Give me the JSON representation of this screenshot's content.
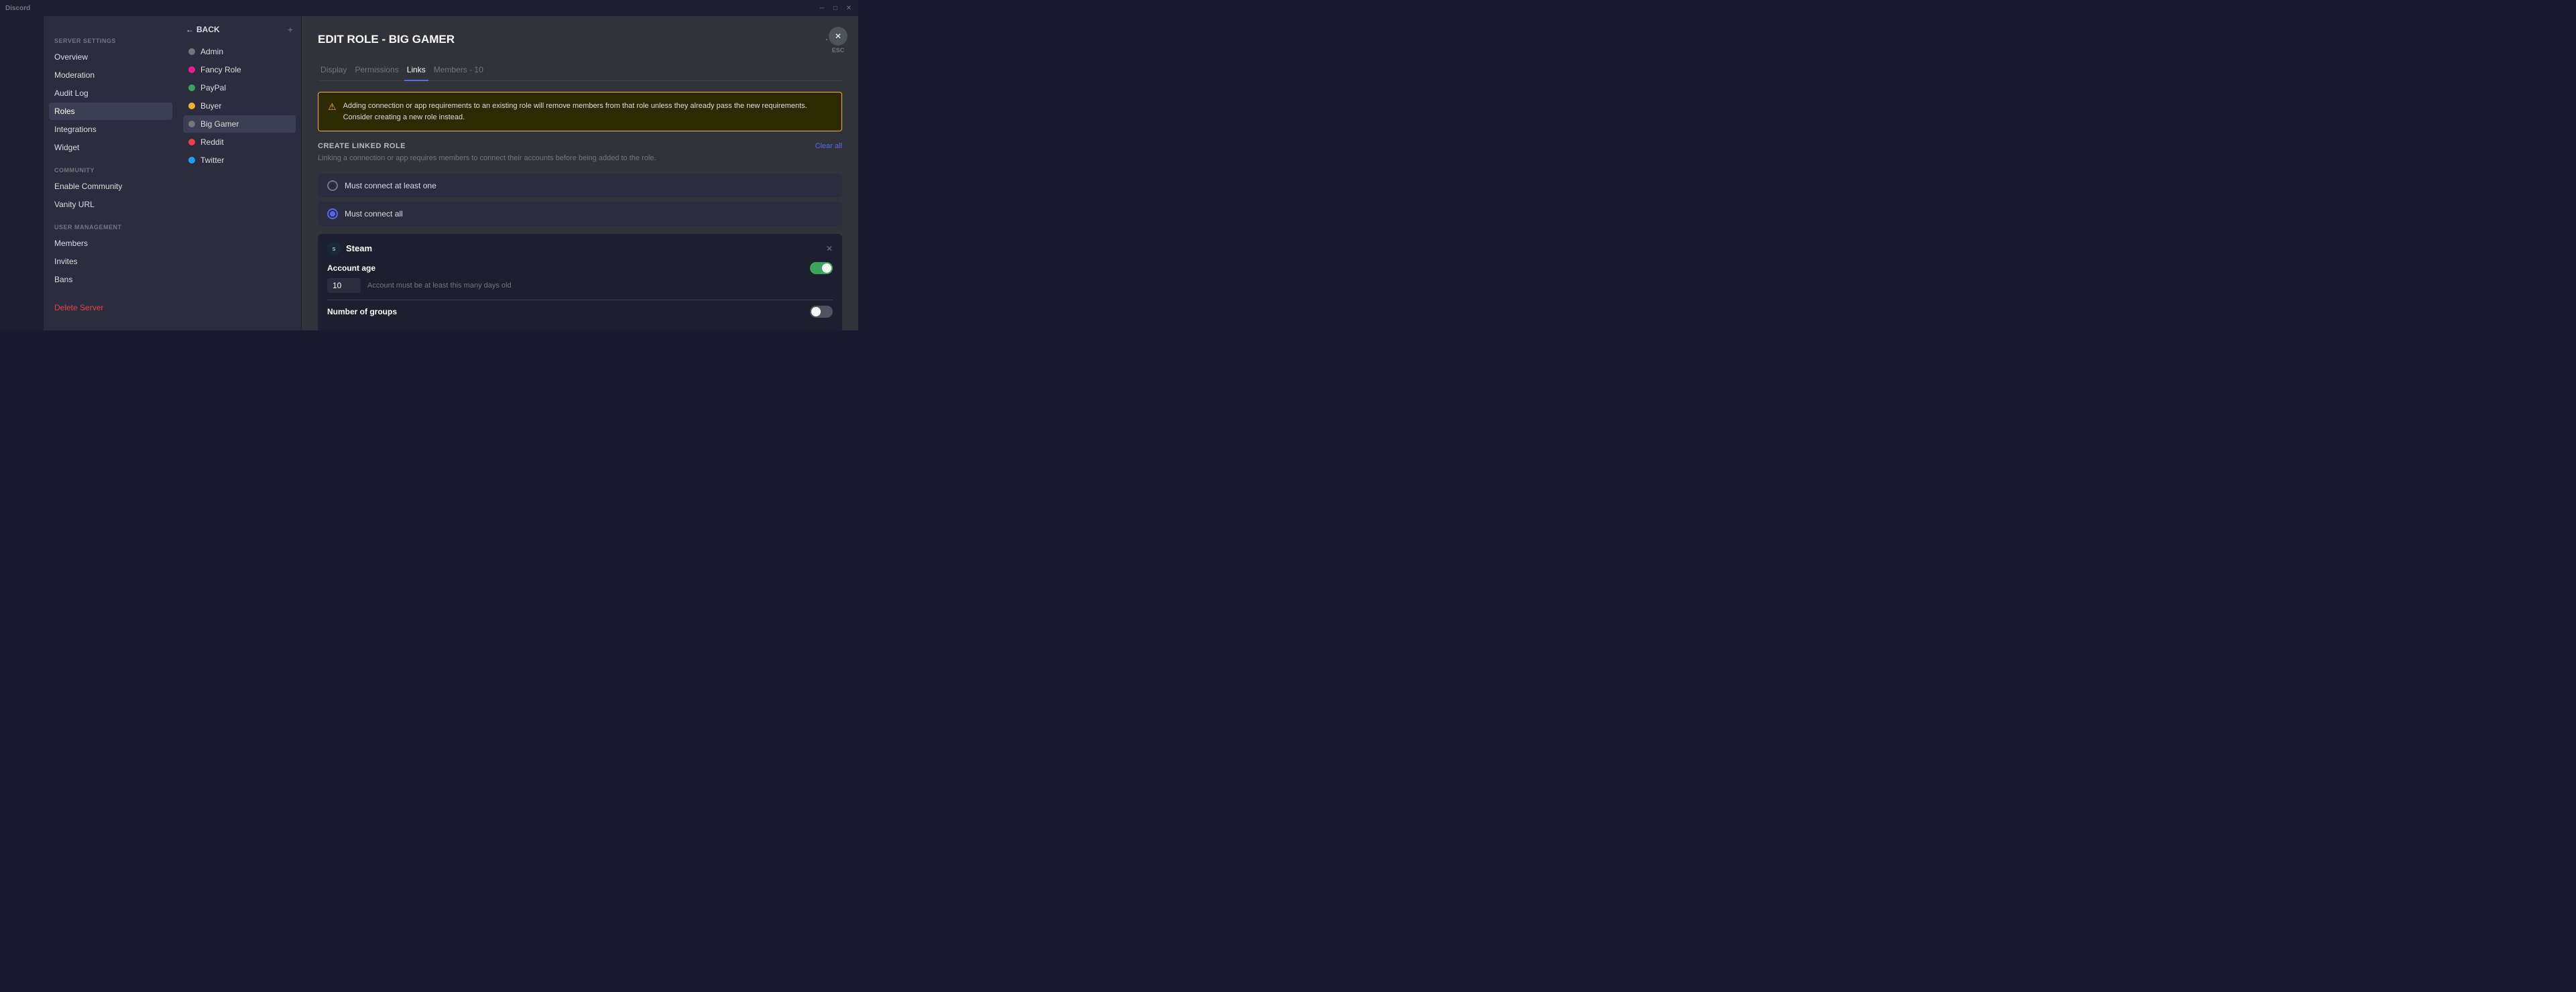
{
  "titleBar": {
    "appName": "Discord",
    "controls": [
      "minimize",
      "maximize",
      "close"
    ]
  },
  "serverSettings": {
    "sectionLabel": "SERVER SETTINGS",
    "items": [
      {
        "id": "overview",
        "label": "Overview",
        "active": false
      },
      {
        "id": "moderation",
        "label": "Moderation",
        "active": false
      },
      {
        "id": "audit-log",
        "label": "Audit Log",
        "active": false
      },
      {
        "id": "roles",
        "label": "Roles",
        "active": true
      },
      {
        "id": "integrations",
        "label": "Integrations",
        "active": false
      },
      {
        "id": "widget",
        "label": "Widget",
        "active": false
      }
    ],
    "communitySectionLabel": "COMMUNITY",
    "communityItems": [
      {
        "id": "enable-community",
        "label": "Enable Community",
        "active": false
      },
      {
        "id": "vanity-url",
        "label": "Vanity URL",
        "active": false
      }
    ],
    "userManagementSectionLabel": "USER MANAGEMENT",
    "userManagementItems": [
      {
        "id": "members",
        "label": "Members",
        "active": false
      },
      {
        "id": "invites",
        "label": "Invites",
        "active": false
      },
      {
        "id": "bans",
        "label": "Bans",
        "active": false
      }
    ],
    "deleteServer": "Delete Server"
  },
  "rolesPanel": {
    "backLabel": "BACK",
    "addIcon": "+",
    "roles": [
      {
        "id": "admin",
        "label": "Admin",
        "color": "#72767d",
        "active": false
      },
      {
        "id": "fancy-role",
        "label": "Fancy Role",
        "color": "#e91e8c",
        "active": false
      },
      {
        "id": "paypal",
        "label": "PayPal",
        "color": "#3ba55c",
        "active": false
      },
      {
        "id": "buyer",
        "label": "Buyer",
        "color": "#f0b232",
        "active": false
      },
      {
        "id": "big-gamer",
        "label": "Big Gamer",
        "color": "#72767d",
        "active": true
      },
      {
        "id": "reddit",
        "label": "Reddit",
        "color": "#ed4245",
        "active": false
      },
      {
        "id": "twitter",
        "label": "Twitter",
        "color": "#1da1f2",
        "active": false
      }
    ]
  },
  "editRole": {
    "title": "EDIT ROLE  -  BIG GAMER",
    "tabs": [
      {
        "id": "display",
        "label": "Display",
        "active": false
      },
      {
        "id": "permissions",
        "label": "Permissions",
        "active": false
      },
      {
        "id": "links",
        "label": "Links",
        "active": true
      },
      {
        "id": "members",
        "label": "Members - 10",
        "active": false
      }
    ],
    "warning": {
      "text": "Adding connection or app requirements to an existing role will remove members from that role unless they already pass the new requirements. Consider creating a new role instead."
    },
    "createLinkedRole": {
      "label": "CREATE LINKED ROLE",
      "clearAll": "Clear all",
      "description": "Linking a connection or app requires members to connect their accounts before being added to the role."
    },
    "radioOptions": [
      {
        "id": "must-connect-at-least-one",
        "label": "Must connect at least one",
        "selected": false
      },
      {
        "id": "must-connect-all",
        "label": "Must connect all",
        "selected": true
      }
    ],
    "steamCard": {
      "title": "Steam",
      "accountAge": {
        "label": "Account age",
        "toggleOn": true,
        "inputValue": "10",
        "inputDesc": "Account must be at least this many days old"
      },
      "numberOfGroups": {
        "label": "Number of groups",
        "toggleOn": false
      }
    },
    "escLabel": "ESC"
  }
}
